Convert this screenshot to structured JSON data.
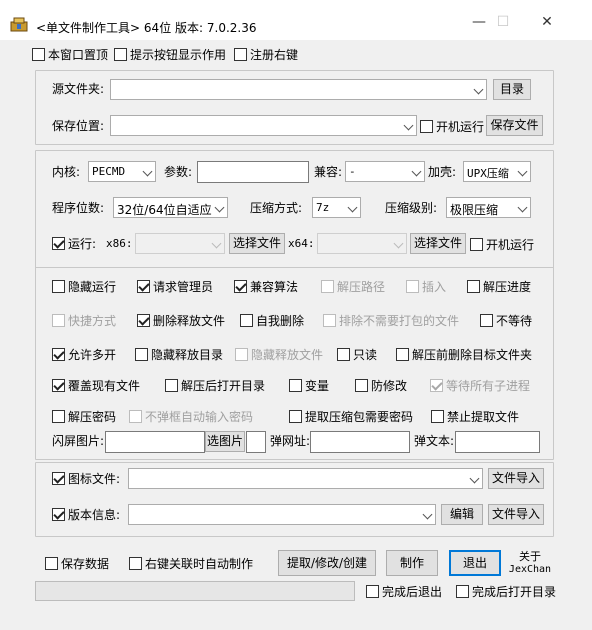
{
  "window": {
    "title": "<单文件制作工具> 64位 版本: 7.0.2.36",
    "minimize": "—",
    "maximize": "☐",
    "close": "✕"
  },
  "top_options": [
    {
      "label": "本窗口置顶",
      "checked": false
    },
    {
      "label": "提示按钮显示作用",
      "checked": false
    },
    {
      "label": "注册右键",
      "checked": false
    }
  ],
  "source": {
    "source_label": "源文件夹:",
    "source_value": "",
    "dir_button": "目录",
    "save_label": "保存位置:",
    "save_value": "",
    "startup_label": "开机运行",
    "save_file_button": "保存文件"
  },
  "config": {
    "core_label": "内核:",
    "core_value": "PECMD",
    "params_label": "参数:",
    "params_value": "",
    "compat_label": "兼容:",
    "compat_value": "-",
    "shell_label": "加壳:",
    "shell_value": "UPX压缩",
    "bits_label": "程序位数:",
    "bits_value": "32位/64位自适应",
    "compress_method_label": "压缩方式:",
    "compress_method_value": "7z",
    "compress_level_label": "压缩级别:",
    "compress_level_value": "极限压缩",
    "run_label": "运行:",
    "x86_label": "x86:",
    "x64_label": "x64:",
    "select_file_x86": "选择文件",
    "select_file_x64": "选择文件",
    "run_startup_label": "开机运行"
  },
  "options": {
    "row1": [
      {
        "label": "隐藏运行",
        "checked": false,
        "disabled": false
      },
      {
        "label": "请求管理员",
        "checked": true,
        "disabled": false
      },
      {
        "label": "兼容算法",
        "checked": true,
        "disabled": false
      },
      {
        "label": "解压路径",
        "checked": false,
        "disabled": true
      },
      {
        "label": "插入",
        "checked": false,
        "disabled": true
      },
      {
        "label": "解压进度",
        "checked": false,
        "disabled": false
      }
    ],
    "row2": [
      {
        "label": "快捷方式",
        "checked": false,
        "disabled": true
      },
      {
        "label": "删除释放文件",
        "checked": true,
        "disabled": false
      },
      {
        "label": "自我删除",
        "checked": false,
        "disabled": false
      },
      {
        "label": "排除不需要打包的文件",
        "checked": false,
        "disabled": true
      },
      {
        "label": "不等待",
        "checked": false,
        "disabled": false
      }
    ],
    "row3": [
      {
        "label": "允许多开",
        "checked": true,
        "disabled": false
      },
      {
        "label": "隐藏释放目录",
        "checked": false,
        "disabled": false
      },
      {
        "label": "隐藏释放文件",
        "checked": false,
        "disabled": true
      },
      {
        "label": "只读",
        "checked": false,
        "disabled": false
      },
      {
        "label": "解压前删除目标文件夹",
        "checked": false,
        "disabled": false
      }
    ],
    "row4": [
      {
        "label": "覆盖现有文件",
        "checked": true,
        "disabled": false
      },
      {
        "label": "解压后打开目录",
        "checked": false,
        "disabled": false
      },
      {
        "label": "变量",
        "checked": false,
        "disabled": false
      },
      {
        "label": "防修改",
        "checked": false,
        "disabled": false
      },
      {
        "label": "等待所有子进程",
        "checked": true,
        "disabled": true
      }
    ],
    "row5": [
      {
        "label": "解压密码",
        "checked": false,
        "disabled": false
      },
      {
        "label": "不弹框自动输入密码",
        "checked": false,
        "disabled": true
      },
      {
        "label": "提取压缩包需要密码",
        "checked": false,
        "disabled": false
      },
      {
        "label": "禁止提取文件",
        "checked": false,
        "disabled": false
      }
    ],
    "splash_label": "闪屏图片:",
    "select_image_button": "选图片",
    "popup_url_label": "弹网址:",
    "popup_text_label": "弹文本:"
  },
  "resources": {
    "icon_label": "图标文件:",
    "icon_import_button": "文件导入",
    "version_label": "版本信息:",
    "edit_button": "编辑",
    "version_import_button": "文件导入"
  },
  "footer": {
    "save_data_label": "保存数据",
    "auto_make_label": "右键关联时自动制作",
    "extract_button": "提取/修改/创建",
    "make_button": "制作",
    "exit_button": "退出",
    "about_line1": "关于",
    "about_line2": "JexChan",
    "exit_after_label": "完成后退出",
    "open_dir_after_label": "完成后打开目录"
  }
}
